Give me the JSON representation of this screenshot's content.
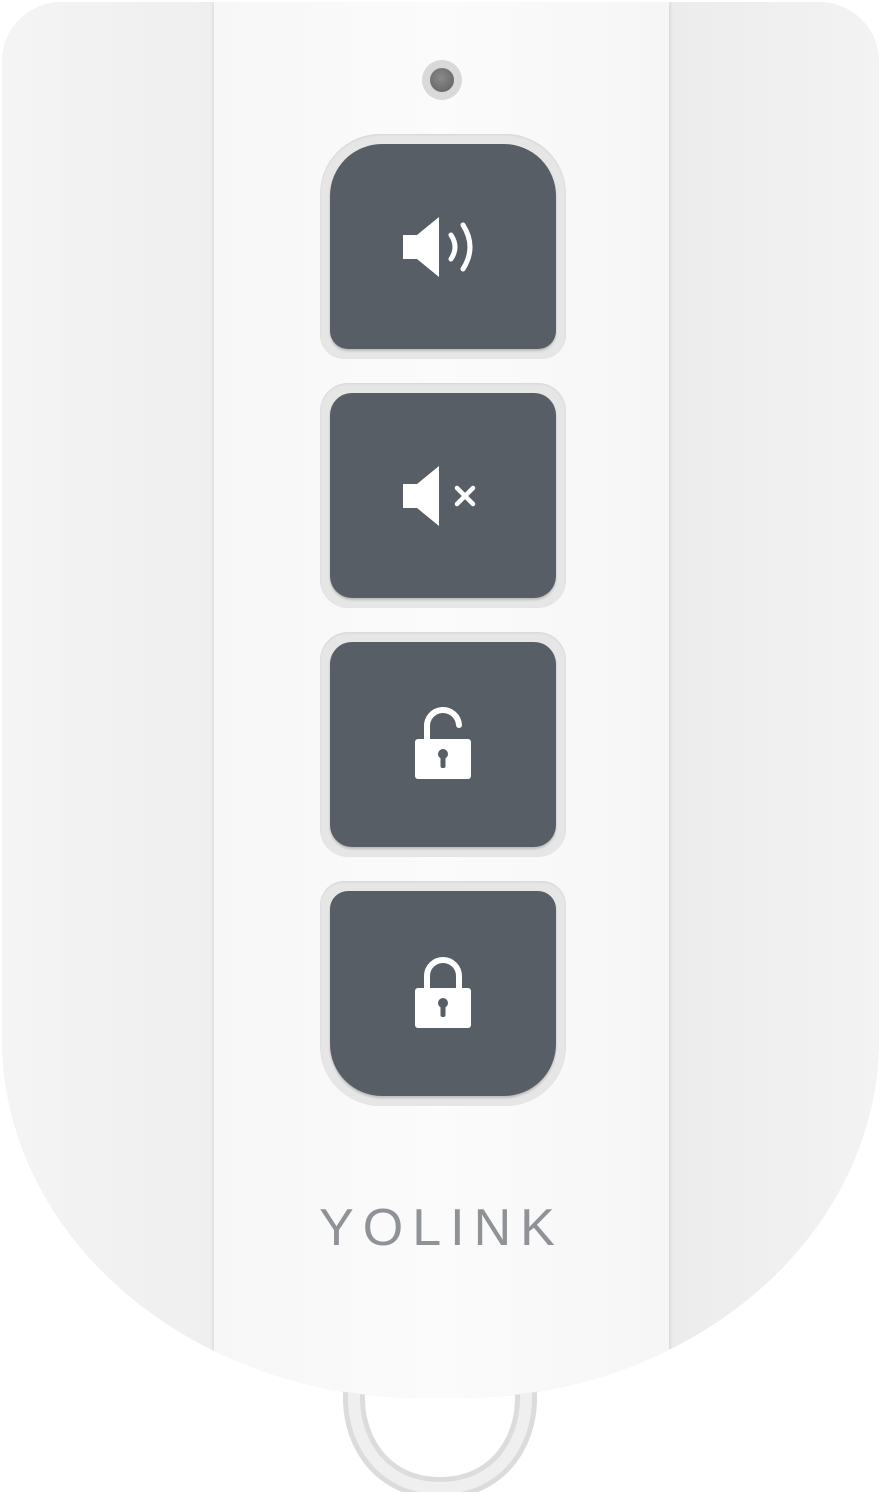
{
  "device": {
    "brand": "YOLINK",
    "colors": {
      "body": "#f1f1f1",
      "button": "#585e66",
      "icon": "#ffffff",
      "brand_text": "#8f9297",
      "led": "#6b6b6b"
    },
    "buttons": [
      {
        "icon": "speaker-on-icon"
      },
      {
        "icon": "speaker-mute-icon"
      },
      {
        "icon": "unlock-icon"
      },
      {
        "icon": "lock-icon"
      }
    ]
  }
}
